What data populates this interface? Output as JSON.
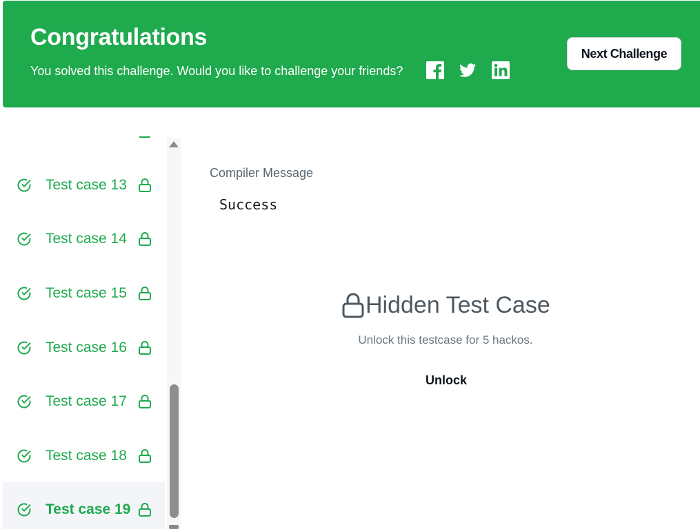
{
  "banner": {
    "title": "Congratulations",
    "subtitle": "You solved this challenge. Would you like to challenge your friends?",
    "share_icons": [
      "facebook-icon",
      "twitter-icon",
      "linkedin-icon"
    ],
    "next_button": "Next Challenge",
    "color": "#1faa4e"
  },
  "sidebar": {
    "test_cases": [
      {
        "label": "Test case 13",
        "passed": true,
        "locked": true,
        "active": false
      },
      {
        "label": "Test case 14",
        "passed": true,
        "locked": true,
        "active": false
      },
      {
        "label": "Test case 15",
        "passed": true,
        "locked": true,
        "active": false
      },
      {
        "label": "Test case 16",
        "passed": true,
        "locked": true,
        "active": false
      },
      {
        "label": "Test case 17",
        "passed": true,
        "locked": true,
        "active": false
      },
      {
        "label": "Test case 18",
        "passed": true,
        "locked": true,
        "active": false
      },
      {
        "label": "Test case 19",
        "passed": true,
        "locked": true,
        "active": true
      }
    ]
  },
  "main": {
    "compiler_label": "Compiler Message",
    "compiler_value": "Success",
    "hidden_title": "Hidden Test Case",
    "unlock_message": "Unlock this testcase for 5 hackos.",
    "unlock_button": "Unlock"
  }
}
